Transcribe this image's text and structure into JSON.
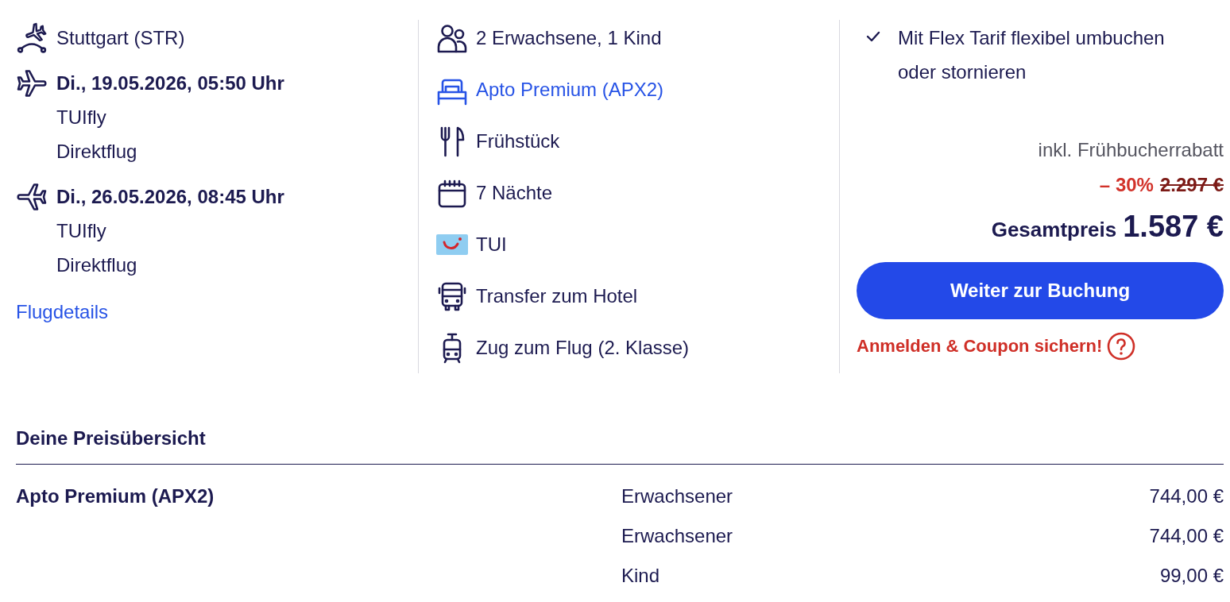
{
  "flight": {
    "origin": "Stuttgart (STR)",
    "legs": [
      {
        "kind": "outbound",
        "datetime": "Di., 19.05.2026, 05:50 Uhr",
        "airline": "TUIfly",
        "type": "Direktflug"
      },
      {
        "kind": "return",
        "datetime": "Di., 26.05.2026, 08:45 Uhr",
        "airline": "TUIfly",
        "type": "Direktflug"
      }
    ],
    "details_link": "Flugdetails"
  },
  "features": [
    {
      "kind": "travellers",
      "text": "2 Erwachsene, 1 Kind",
      "link": false
    },
    {
      "kind": "room",
      "text": "Apto Premium (APX2)",
      "link": true
    },
    {
      "kind": "board",
      "text": "Frühstück",
      "link": false
    },
    {
      "kind": "duration",
      "text": "7 Nächte",
      "link": false
    },
    {
      "kind": "operator",
      "text": "TUI",
      "link": false
    },
    {
      "kind": "transfer",
      "text": "Transfer zum Hotel",
      "link": false
    },
    {
      "kind": "train",
      "text": "Zug zum Flug (2. Klasse)",
      "link": false
    }
  ],
  "offer": {
    "benefits": [
      {
        "text": "Mit Flex Tarif flexibel umbuchen oder stornieren",
        "checked": true
      }
    ],
    "discount_note": "inkl. Frühbucherrabatt",
    "discount": "– 30%",
    "old_price": "2.297 €",
    "total_label": "Gesamtpreis",
    "total": "1.587 €",
    "button": "Weiter zur Buchung",
    "coupon_link": "Anmelden & Coupon sichern!"
  },
  "price_overview": {
    "title": "Deine Preisübersicht",
    "groups": [
      {
        "name": "Apto Premium (APX2)",
        "rows": [
          {
            "label": "Erwachsener",
            "amount": "744,00 €"
          },
          {
            "label": "Erwachsener",
            "amount": "744,00 €"
          },
          {
            "label": "Kind",
            "amount": "99,00 €"
          }
        ]
      }
    ]
  }
}
